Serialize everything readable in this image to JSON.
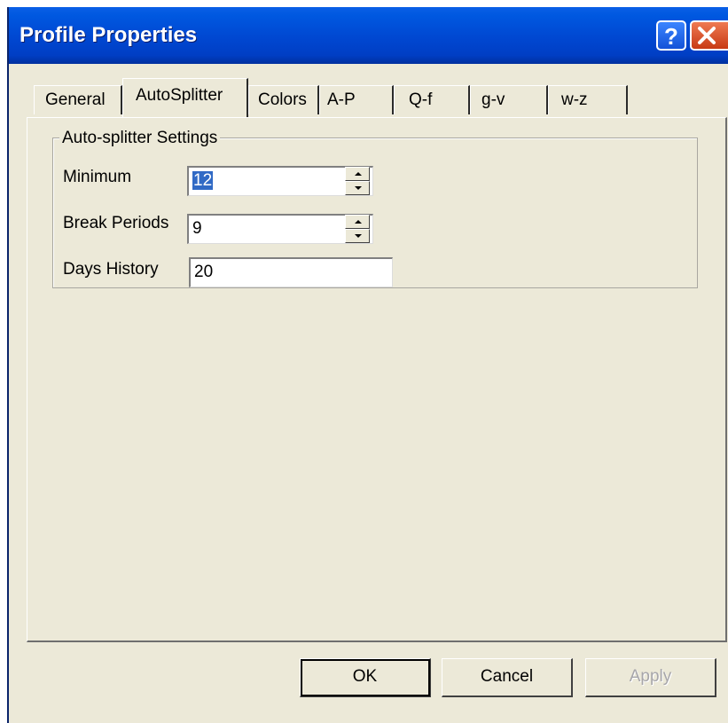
{
  "window": {
    "title": "Profile Properties"
  },
  "titlebar": {
    "help_glyph": "?",
    "help_icon": "help-icon",
    "close_icon": "close-icon"
  },
  "tabs": [
    {
      "label": "General",
      "active": false
    },
    {
      "label": "AutoSplitter",
      "active": true
    },
    {
      "label": "Colors",
      "active": false
    },
    {
      "label": "A-P",
      "active": false
    },
    {
      "label": "Q-f",
      "active": false
    },
    {
      "label": "g-v",
      "active": false
    },
    {
      "label": "w-z",
      "active": false
    }
  ],
  "group": {
    "title": "Auto-splitter Settings",
    "fields": {
      "minimum": {
        "label": "Minimum",
        "value": "12"
      },
      "break_periods": {
        "label": "Break Periods",
        "value": "9"
      },
      "days_history": {
        "label": "Days History",
        "value": "20"
      }
    }
  },
  "buttons": {
    "ok": "OK",
    "cancel": "Cancel",
    "apply": "Apply"
  },
  "colors": {
    "titlebar": "#0047d1",
    "dialog_bg": "#ece9d8",
    "close_button": "#d8542a",
    "selection": "#316ac5"
  }
}
